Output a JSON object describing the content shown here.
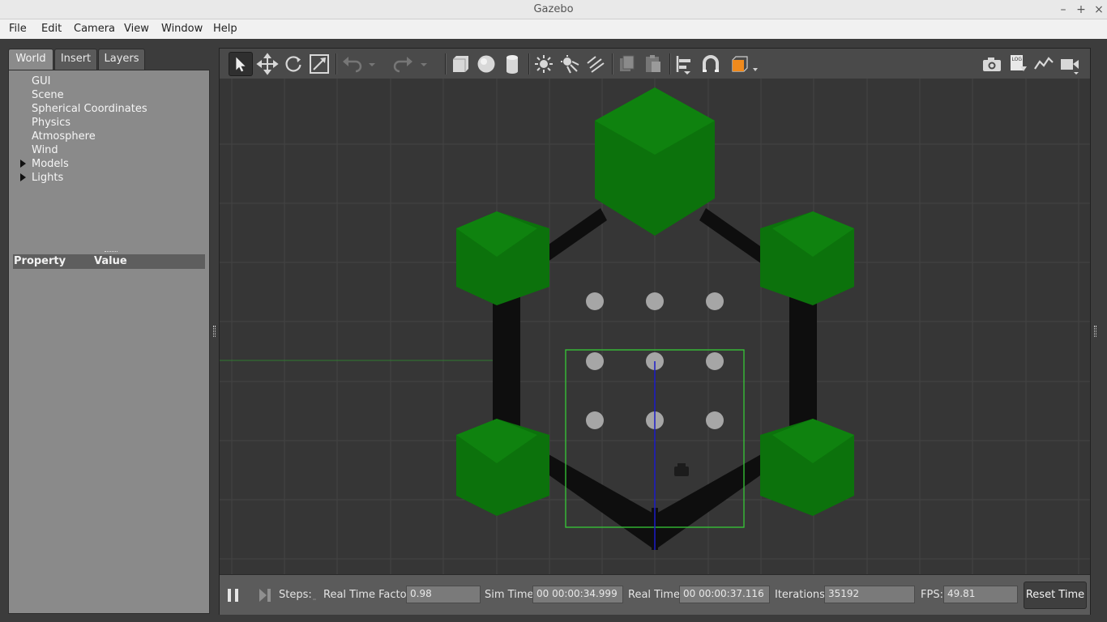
{
  "window": {
    "title": "Gazebo"
  },
  "menu": [
    "File",
    "Edit",
    "Camera",
    "View",
    "Window",
    "Help"
  ],
  "tabs": [
    "World",
    "Insert",
    "Layers"
  ],
  "world_tree": {
    "items": [
      "GUI",
      "Scene",
      "Spherical Coordinates",
      "Physics",
      "Atmosphere",
      "Wind"
    ],
    "expandable": [
      "Models",
      "Lights"
    ]
  },
  "properties": {
    "col_property": "Property",
    "col_value": "Value"
  },
  "toolbar_icons": [
    "select-mode-icon",
    "translate-icon",
    "rotate-icon",
    "scale-icon",
    "undo-icon",
    "redo-icon",
    "box-shape-icon",
    "sphere-shape-icon",
    "cylinder-shape-icon",
    "point-light-icon",
    "spot-light-icon",
    "directional-light-icon",
    "copy-icon",
    "paste-icon",
    "align-icon",
    "snap-icon",
    "view-angle-icon",
    "screenshot-icon",
    "log-icon",
    "plot-icon",
    "record-video-icon"
  ],
  "bottom": {
    "steps_label": "Steps:",
    "rtf_label": "Real Time Factor:",
    "rtf_value": "0.98",
    "sim_label": "Sim Time:",
    "sim_value": "00 00:00:34.999",
    "real_label": "Real Time:",
    "real_value": "00 00:00:37.116",
    "iter_label": "Iterations:",
    "iter_value": "35192",
    "fps_label": "FPS:",
    "fps_value": "49.81",
    "reset_label": "Reset Time"
  },
  "colors": {
    "cube_green": "#0b7a0b",
    "frame_black": "#0d0d0d",
    "selection": "#3ad33a",
    "accent_orange": "#f08a1c"
  }
}
